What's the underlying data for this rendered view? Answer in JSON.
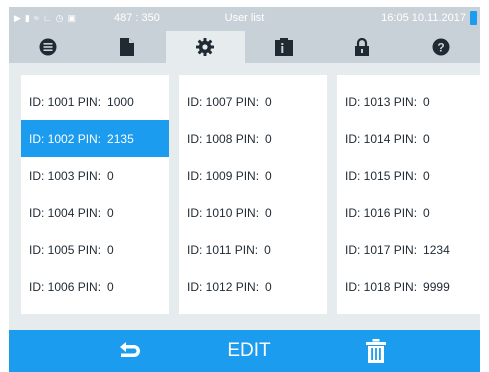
{
  "status_bar": {
    "icons": [
      "play-icon",
      "document-icon",
      "steam-icon",
      "chart-icon",
      "clock-icon",
      "lock-icon"
    ],
    "coords": "487 : 350",
    "title": "User list",
    "datetime": "16:05  10.11.2017"
  },
  "tabs": [
    {
      "icon": "menu-icon",
      "active": false
    },
    {
      "icon": "document-icon",
      "active": false
    },
    {
      "icon": "gear-icon",
      "active": true
    },
    {
      "icon": "info-box-icon",
      "active": false
    },
    {
      "icon": "lock-icon",
      "active": false
    },
    {
      "icon": "help-icon",
      "active": false
    }
  ],
  "users": {
    "col1": [
      {
        "id": "ID: 1001 PIN:",
        "pin": "1000",
        "selected": false
      },
      {
        "id": "ID: 1002 PIN:",
        "pin": "2135",
        "selected": true
      },
      {
        "id": "ID: 1003 PIN:",
        "pin": "0",
        "selected": false
      },
      {
        "id": "ID: 1004 PIN:",
        "pin": "0",
        "selected": false
      },
      {
        "id": "ID: 1005 PIN:",
        "pin": "0",
        "selected": false
      },
      {
        "id": "ID: 1006 PIN:",
        "pin": "0",
        "selected": false
      }
    ],
    "col2": [
      {
        "id": "ID: 1007 PIN:",
        "pin": "0"
      },
      {
        "id": "ID: 1008 PIN:",
        "pin": "0"
      },
      {
        "id": "ID: 1009 PIN:",
        "pin": "0"
      },
      {
        "id": "ID: 1010 PIN:",
        "pin": "0"
      },
      {
        "id": "ID: 1011 PIN:",
        "pin": "0"
      },
      {
        "id": "ID: 1012 PIN:",
        "pin": "0"
      }
    ],
    "col3": [
      {
        "id": "ID: 1013 PIN:",
        "pin": "0"
      },
      {
        "id": "ID: 1014 PIN:",
        "pin": "0"
      },
      {
        "id": "ID: 1015 PIN:",
        "pin": "0"
      },
      {
        "id": "ID: 1016 PIN:",
        "pin": "0"
      },
      {
        "id": "ID: 1017 PIN:",
        "pin": "1234"
      },
      {
        "id": "ID: 1018 PIN:",
        "pin": "9999"
      }
    ]
  },
  "footer": {
    "back_icon": "back-arrow-icon",
    "edit_label": "EDIT",
    "delete_icon": "trash-icon"
  },
  "colors": {
    "accent": "#1b9cef",
    "bar_gray": "#c9d1d8",
    "panel_bg": "#e6ebee",
    "icon_dark": "#1f2a33"
  }
}
